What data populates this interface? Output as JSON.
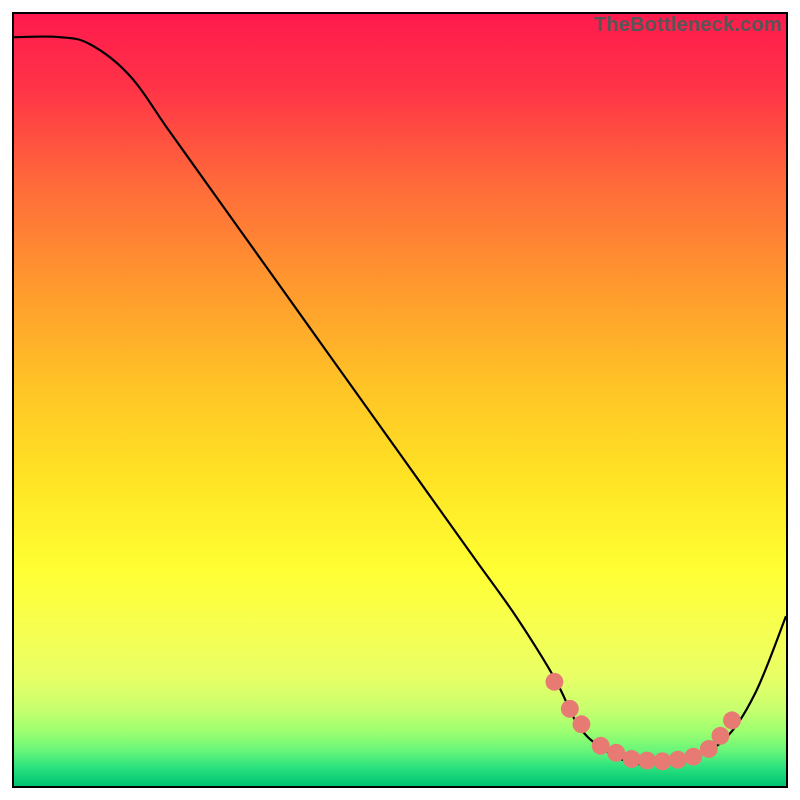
{
  "attribution": "TheBottleneck.com",
  "chart_data": {
    "type": "line",
    "title": "",
    "xlabel": "",
    "ylabel": "",
    "xlim": [
      0,
      100
    ],
    "ylim": [
      0,
      100
    ],
    "background_gradient": [
      "#ff1a4d",
      "#ff5a3c",
      "#ff9a2e",
      "#ffd924",
      "#ffff33",
      "#f2ff5c",
      "#c8ff66",
      "#7fff66",
      "#00d97a",
      "#00c472"
    ],
    "series": [
      {
        "name": "bottleneck-curve",
        "color": "#000000",
        "x": [
          0,
          6,
          10,
          15,
          20,
          25,
          30,
          35,
          40,
          45,
          50,
          55,
          60,
          65,
          70,
          73,
          76,
          80,
          84,
          88,
          92,
          96,
          100
        ],
        "values": [
          97,
          97,
          96,
          92,
          85,
          78,
          71,
          64,
          57,
          50,
          43,
          36,
          29,
          22,
          14,
          8,
          5,
          3,
          3,
          4,
          6,
          12,
          22
        ]
      }
    ],
    "markers": {
      "name": "highlight-dots",
      "color": "#e77b74",
      "radius": 9,
      "x": [
        70.0,
        72.0,
        73.5,
        76.0,
        78.0,
        80.0,
        82.0,
        84.0,
        86.0,
        88.0,
        90.0,
        91.5,
        93.0
      ],
      "values": [
        13.5,
        10.0,
        8.0,
        5.2,
        4.3,
        3.5,
        3.3,
        3.2,
        3.4,
        3.8,
        4.8,
        6.5,
        8.5
      ]
    }
  }
}
